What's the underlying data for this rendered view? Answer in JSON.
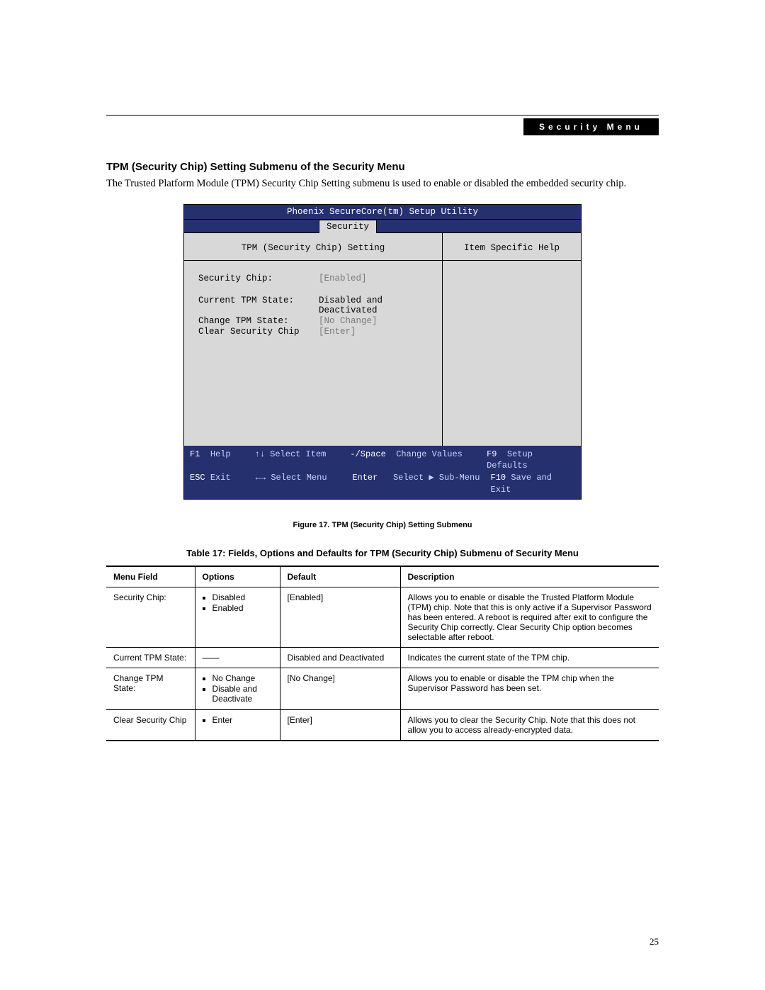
{
  "header": {
    "tag": "Security Menu"
  },
  "section": {
    "title": "TPM (Security Chip) Setting Submenu of the Security Menu",
    "intro": "The Trusted Platform Module (TPM) Security Chip Setting submenu is used to enable or disabled the embedded security chip."
  },
  "bios": {
    "app_title": "Phoenix SecureCore(tm) Setup Utility",
    "tab_active": "Security",
    "pane_title_left": "TPM (Security Chip) Setting",
    "pane_title_right": "Item Specific Help",
    "rows": [
      {
        "label": "Security Chip:",
        "value": "[Enabled]",
        "grey": true
      },
      {
        "gap": true
      },
      {
        "label": "Current TPM State:",
        "value": "Disabled and Deactivated",
        "grey": false
      },
      {
        "label": "Change TPM State:",
        "value": "[No Change]",
        "grey": true
      },
      {
        "label": "Clear Security Chip",
        "value": "[Enter]",
        "grey": true
      }
    ],
    "footer": {
      "r1": {
        "k1": "F1",
        "a1": "Help",
        "arr1": "↑↓",
        "a2": "Select Item",
        "k2": "-/Space",
        "a3": "Change Values",
        "k3": "F9",
        "a4": "Setup Defaults"
      },
      "r2": {
        "k1": "ESC",
        "a1": "Exit",
        "arr1": "←→",
        "a2": "Select Menu",
        "k2": "Enter",
        "a3": "Select ▶ Sub-Menu",
        "k3": "F10",
        "a4": "Save and Exit"
      }
    }
  },
  "caption": "Figure 17.  TPM (Security Chip) Setting Submenu",
  "table": {
    "title": "Table 17: Fields, Options and Defaults for TPM (Security Chip) Submenu of Security Menu",
    "headers": {
      "menu_field": "Menu Field",
      "options": "Options",
      "default": "Default",
      "description": "Description"
    },
    "rows": [
      {
        "menu_field": "Security Chip:",
        "options": [
          "Disabled",
          "Enabled"
        ],
        "default": "[Enabled]",
        "description": "Allows you to enable or disable the Trusted Platform Module (TPM) chip. Note that this is only active if a Supervisor Password has been entered. A reboot is required after exit to configure the Security Chip correctly. Clear Security Chip option becomes selectable after reboot."
      },
      {
        "menu_field": "Current TPM State:",
        "options_raw": "——",
        "default": "Disabled and Deactivated",
        "description": "Indicates the current state of the TPM chip."
      },
      {
        "menu_field": "Change TPM State:",
        "options": [
          "No Change",
          "Disable and Deactivate"
        ],
        "default": "[No Change]",
        "description": "Allows you to enable or disable the TPM chip when the Supervisor Password has been set."
      },
      {
        "menu_field": "Clear Security Chip",
        "options": [
          "Enter"
        ],
        "default": "[Enter]",
        "description": "Allows you to clear the Security Chip. Note that this does not allow you to access already-encrypted data."
      }
    ]
  },
  "page_number": "25"
}
